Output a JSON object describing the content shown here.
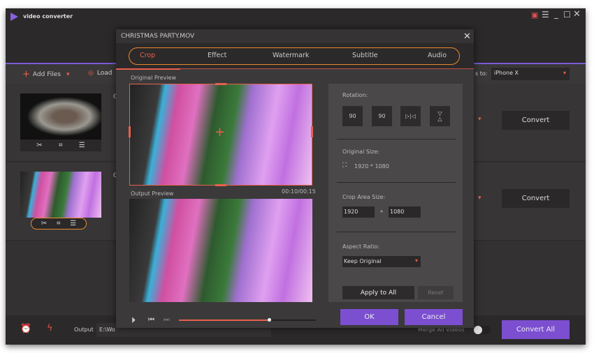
{
  "app": {
    "title": "video converter",
    "brand_color": "#7a5bd6"
  },
  "window_controls": [
    "gift-icon",
    "menu-icon",
    "minimize-icon",
    "maximize-icon",
    "close-icon"
  ],
  "toolbar": {
    "add_files": "Add Files",
    "load": "Load",
    "convert_to_label": "s to:",
    "format": "iPhone X"
  },
  "rows": [
    {
      "convert": "Convert",
      "letter": "C"
    },
    {
      "convert": "Convert",
      "letter": "C"
    }
  ],
  "bottom": {
    "output_label": "Output",
    "output_path": "E:\\Wo",
    "merge_label": "Merge All Videos",
    "convert_all": "Convert All"
  },
  "dialog": {
    "title": "CHRISTMAS PARTY.MOV",
    "tabs": [
      "Crop",
      "Effect",
      "Watermark",
      "Subtitle",
      "Audio"
    ],
    "active_tab": "Crop",
    "original_preview": "Original Preview",
    "output_preview": "Output Preview",
    "time": "00:10/00:15",
    "progress": 0.66,
    "rotation_label": "Rotation:",
    "rotate_left": "90",
    "rotate_right": "90",
    "original_size_label": "Original Size:",
    "original_size": "1920 * 1080",
    "crop_area_label": "Crop Area Size:",
    "crop_width": "1920",
    "crop_sep": "*",
    "crop_height": "1080",
    "aspect_label": "Aspect Ratio:",
    "aspect_value": "Keep Original",
    "apply_all": "Apply to All",
    "reset": "Reset",
    "ok": "OK",
    "cancel": "Cancel"
  },
  "colors": {
    "accent": "#e8604c",
    "highlight_ring": "#e88a2c",
    "button": "#7c4fd0"
  }
}
